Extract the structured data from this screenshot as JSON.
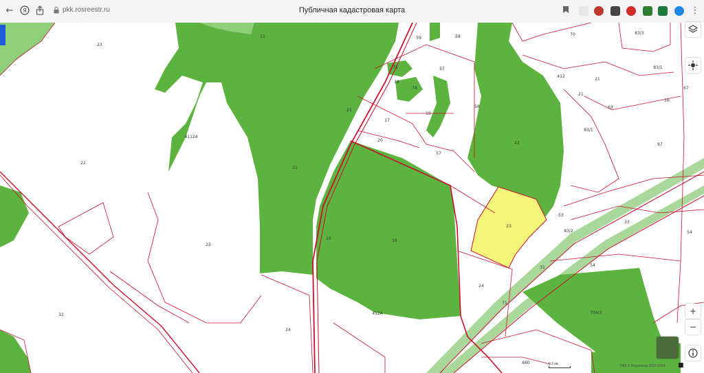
{
  "browser": {
    "url": "pkk.rosreestr.ru",
    "title": "Публичная кадастровая карта",
    "back_icon": "back-arrow-icon",
    "forward_icon": "forward-arrow-icon"
  },
  "map": {
    "colors": {
      "forest": "#5cb33f",
      "light_green": "#8fcf7a",
      "selected": "#f5f57a",
      "boundary": "#c8102e",
      "road": "#a9d89a"
    },
    "parcel_labels": [
      {
        "id": "21a",
        "text": "21"
      },
      {
        "id": "23a",
        "text": "23"
      },
      {
        "id": "22",
        "text": "22"
      },
      {
        "id": "21b",
        "text": "21"
      },
      {
        "id": "21c",
        "text": "21"
      },
      {
        "id": "41124",
        "text": "41124"
      },
      {
        "id": "23b",
        "text": "23"
      },
      {
        "id": "32",
        "text": "32"
      },
      {
        "id": "16a",
        "text": "16"
      },
      {
        "id": "16b",
        "text": "16"
      },
      {
        "id": "24a",
        "text": "24"
      },
      {
        "id": "59",
        "text": "59"
      },
      {
        "id": "58a",
        "text": "58"
      },
      {
        "id": "57a",
        "text": "57"
      },
      {
        "id": "72",
        "text": "72"
      },
      {
        "id": "18",
        "text": "18"
      },
      {
        "id": "74",
        "text": "74"
      },
      {
        "id": "19",
        "text": "19"
      },
      {
        "id": "17",
        "text": "17"
      },
      {
        "id": "20",
        "text": "20"
      },
      {
        "id": "57b",
        "text": "57"
      },
      {
        "id": "58b",
        "text": "58"
      },
      {
        "id": "42",
        "text": "42"
      },
      {
        "id": "23c",
        "text": "23"
      },
      {
        "id": "53",
        "text": "53"
      },
      {
        "id": "83_2",
        "text": "83/2"
      },
      {
        "id": "31",
        "text": "31"
      },
      {
        "id": "24b",
        "text": "24"
      },
      {
        "id": "71",
        "text": "71"
      },
      {
        "id": "412a",
        "text": "412А"
      },
      {
        "id": "70",
        "text": "70"
      },
      {
        "id": "83_3",
        "text": "83/3"
      },
      {
        "id": "83_1a",
        "text": "83/1"
      },
      {
        "id": "83_1b",
        "text": "83/1"
      },
      {
        "id": "21d",
        "text": "21"
      },
      {
        "id": "21e",
        "text": "21"
      },
      {
        "id": "16c",
        "text": "16"
      },
      {
        "id": "67a",
        "text": "67"
      },
      {
        "id": "67b",
        "text": "67"
      },
      {
        "id": "63",
        "text": "63"
      },
      {
        "id": "33",
        "text": "33"
      },
      {
        "id": "54a",
        "text": "54"
      },
      {
        "id": "54b",
        "text": "54"
      },
      {
        "id": "704_2",
        "text": "704/2"
      },
      {
        "id": "660",
        "text": "660"
      },
      {
        "id": "412b",
        "text": "412"
      }
    ]
  },
  "scale": "0.2 км",
  "copyright": "ПКК © Росреестр 2010-2024",
  "controls": {
    "layers_icon": "layers-icon",
    "locate_icon": "locate-icon",
    "zoom_in": "+",
    "zoom_out": "−",
    "info_icon": "info-icon",
    "basemap_icon": "basemap-thumbnail-icon"
  }
}
